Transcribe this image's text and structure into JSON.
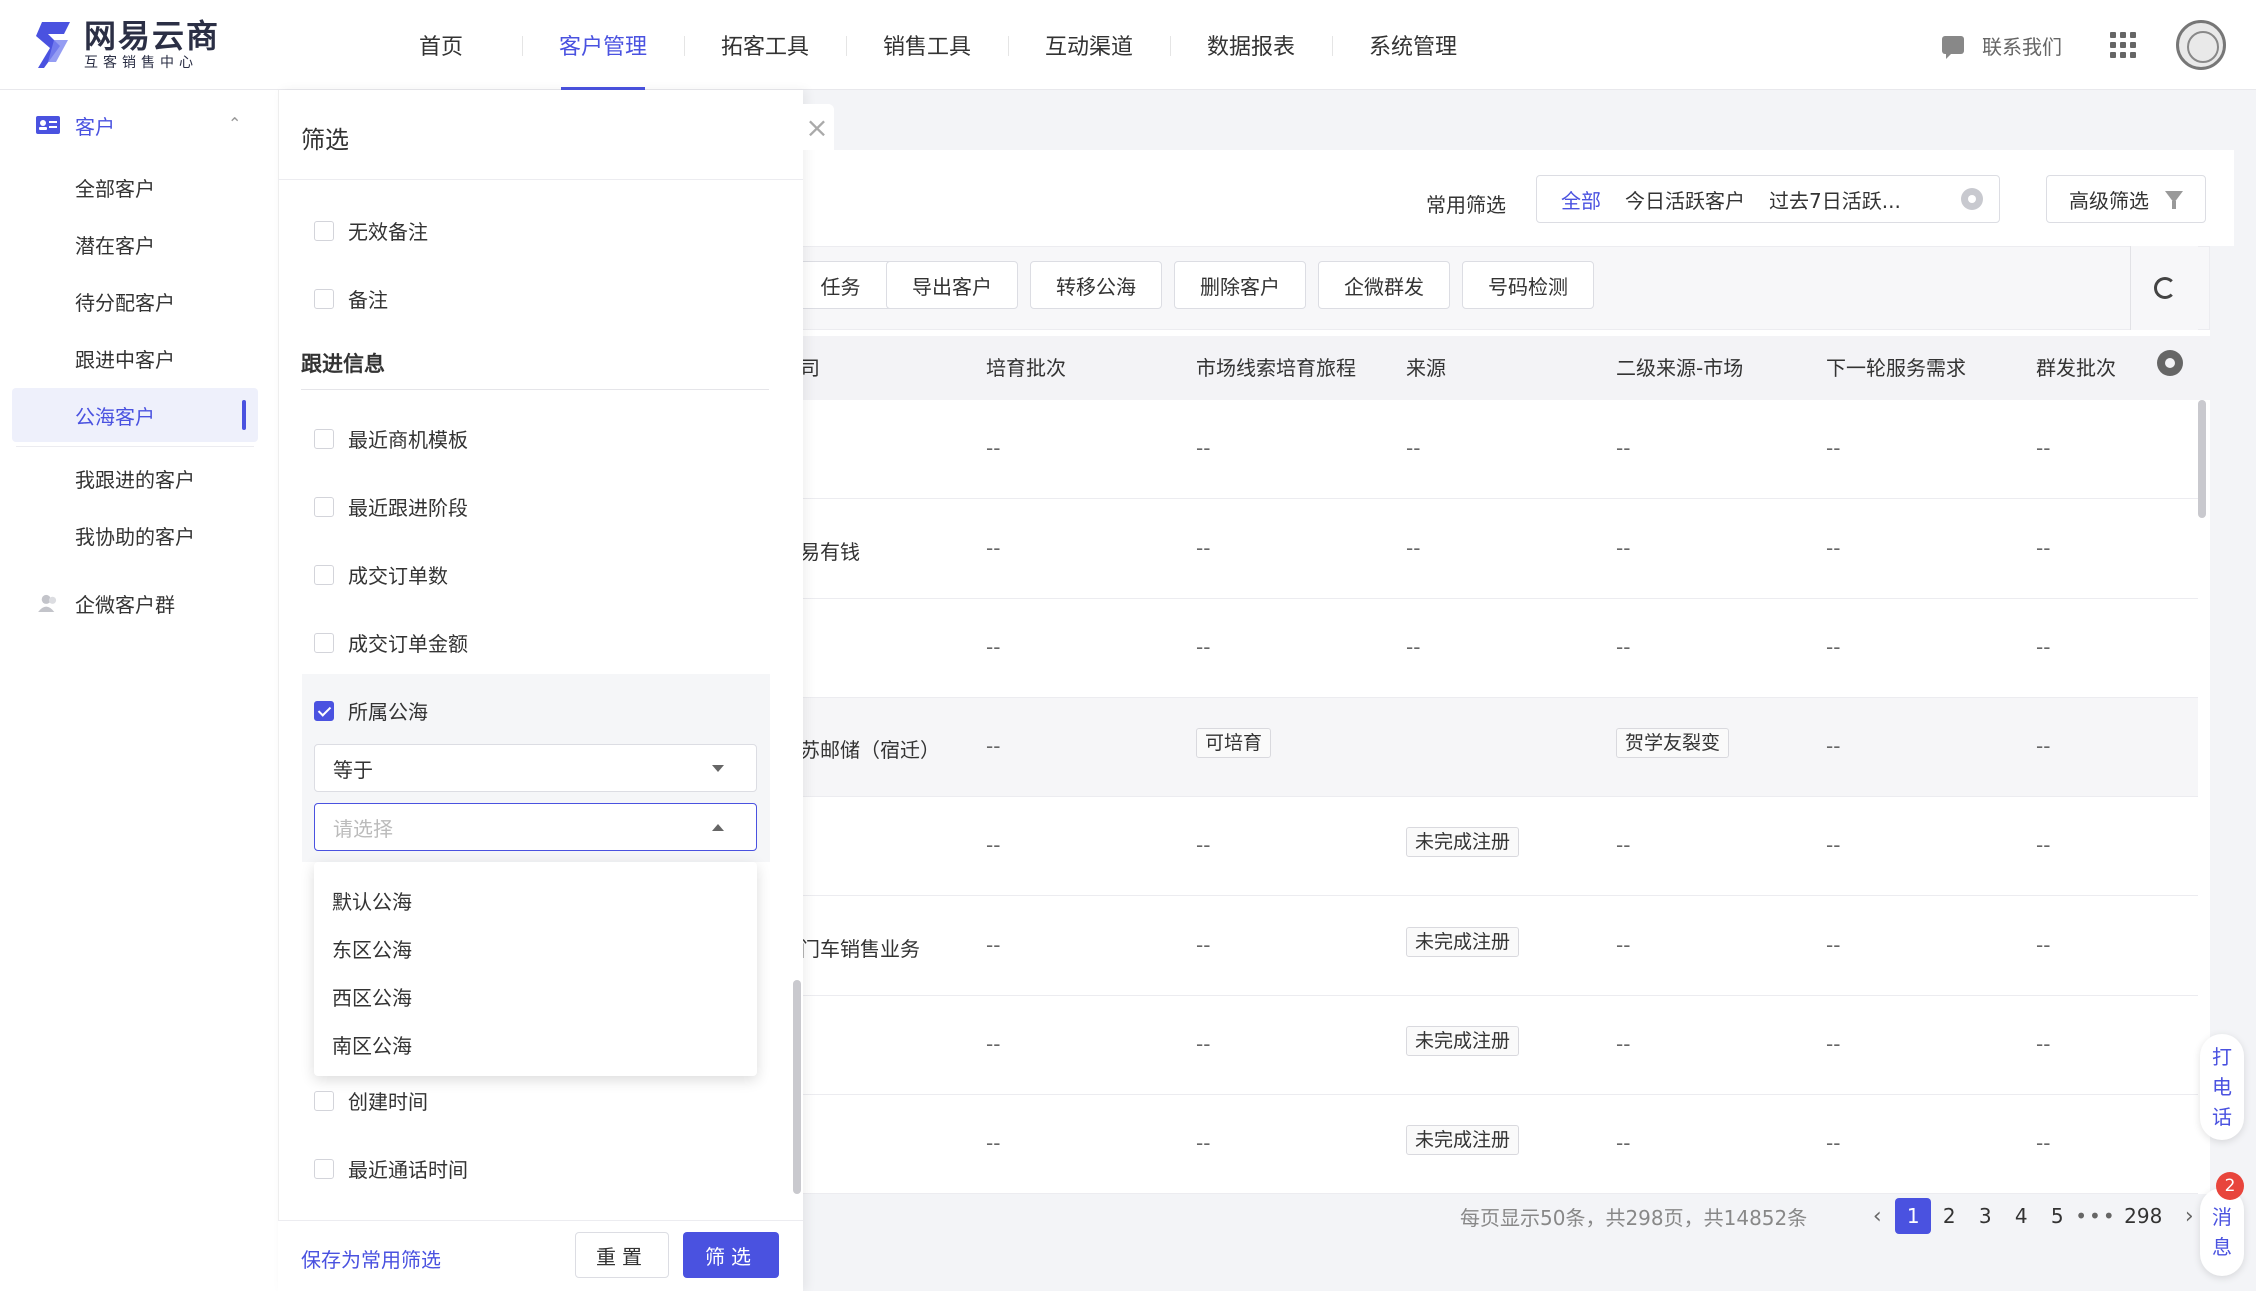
{
  "logo": {
    "title": "网易云商",
    "subtitle": "互客销售中心"
  },
  "nav": {
    "items": [
      "首页",
      "客户管理",
      "拓客工具",
      "销售工具",
      "互动渠道",
      "数据报表",
      "系统管理"
    ],
    "active_index": 1
  },
  "header_right": {
    "contact": "联系我们"
  },
  "sidebar": {
    "group_customer": "客户",
    "items": [
      "全部客户",
      "潜在客户",
      "待分配客户",
      "跟进中客户",
      "公海客户",
      "我跟进的客户",
      "我协助的客户"
    ],
    "active_item": "公海客户",
    "group_wecom": "企微客户群"
  },
  "filter_bar": {
    "label": "常用筛选",
    "options": [
      "全部",
      "今日活跃客户",
      "过去7日活跃..."
    ],
    "active_option": "全部",
    "advanced": "高级筛选"
  },
  "toolbar": {
    "buttons": [
      "任务",
      "导出客户",
      "转移公海",
      "删除客户",
      "企微群发",
      "号码检测"
    ]
  },
  "table": {
    "headers": [
      "司",
      "培育批次",
      "市场线索培育旅程",
      "来源",
      "二级来源-市场",
      "下一轮服务需求",
      "群发批次"
    ],
    "rows": [
      [
        "",
        "--",
        "--",
        "--",
        "--",
        "--",
        "--"
      ],
      [
        "易有钱",
        "--",
        "--",
        "--",
        "--",
        "--",
        "--"
      ],
      [
        "",
        "--",
        "--",
        "--",
        "--",
        "--",
        "--"
      ],
      [
        "苏邮储（宿迁）",
        "--",
        "可培育",
        "",
        "贺学友裂变",
        "--",
        "--"
      ],
      [
        "",
        "--",
        "--",
        "未完成注册",
        "--",
        "--",
        "--"
      ],
      [
        "门车销售业务",
        "--",
        "--",
        "未完成注册",
        "--",
        "--",
        "--"
      ],
      [
        "",
        "--",
        "--",
        "未完成注册",
        "--",
        "--",
        "--"
      ],
      [
        "",
        "--",
        "--",
        "未完成注册",
        "--",
        "--",
        "--"
      ]
    ]
  },
  "pagination": {
    "summary": "每页显示50条，共298页，共14852条",
    "pages": [
      "1",
      "2",
      "3",
      "4",
      "5"
    ],
    "current": "1",
    "ellipsis": "•••",
    "last": "298"
  },
  "floating": {
    "call": [
      "打",
      "电",
      "话"
    ],
    "message": [
      "消",
      "息"
    ],
    "badge": "2"
  },
  "drawer": {
    "title": "筛选",
    "close": "×",
    "top_items": [
      {
        "label": "无效备注",
        "checked": false
      },
      {
        "label": "备注",
        "checked": false
      }
    ],
    "section_title": "跟进信息",
    "section_items": [
      {
        "label": "最近商机模板",
        "checked": false
      },
      {
        "label": "最近跟进阶段",
        "checked": false
      },
      {
        "label": "成交订单数",
        "checked": false
      },
      {
        "label": "成交订单金额",
        "checked": false
      }
    ],
    "selected_item": {
      "label": "所属公海",
      "checked": true
    },
    "operator_value": "等于",
    "value_placeholder": "请选择",
    "dropdown_options": [
      "默认公海",
      "东区公海",
      "西区公海",
      "南区公海"
    ],
    "bottom_items": [
      {
        "label": "创建时间",
        "checked": false
      },
      {
        "label": "最近通话时间",
        "checked": false
      }
    ],
    "save_link": "保存为常用筛选",
    "reset": "重置",
    "apply": "筛选"
  },
  "colors": {
    "accent": "#4a52e0",
    "badge": "#e8453c"
  }
}
